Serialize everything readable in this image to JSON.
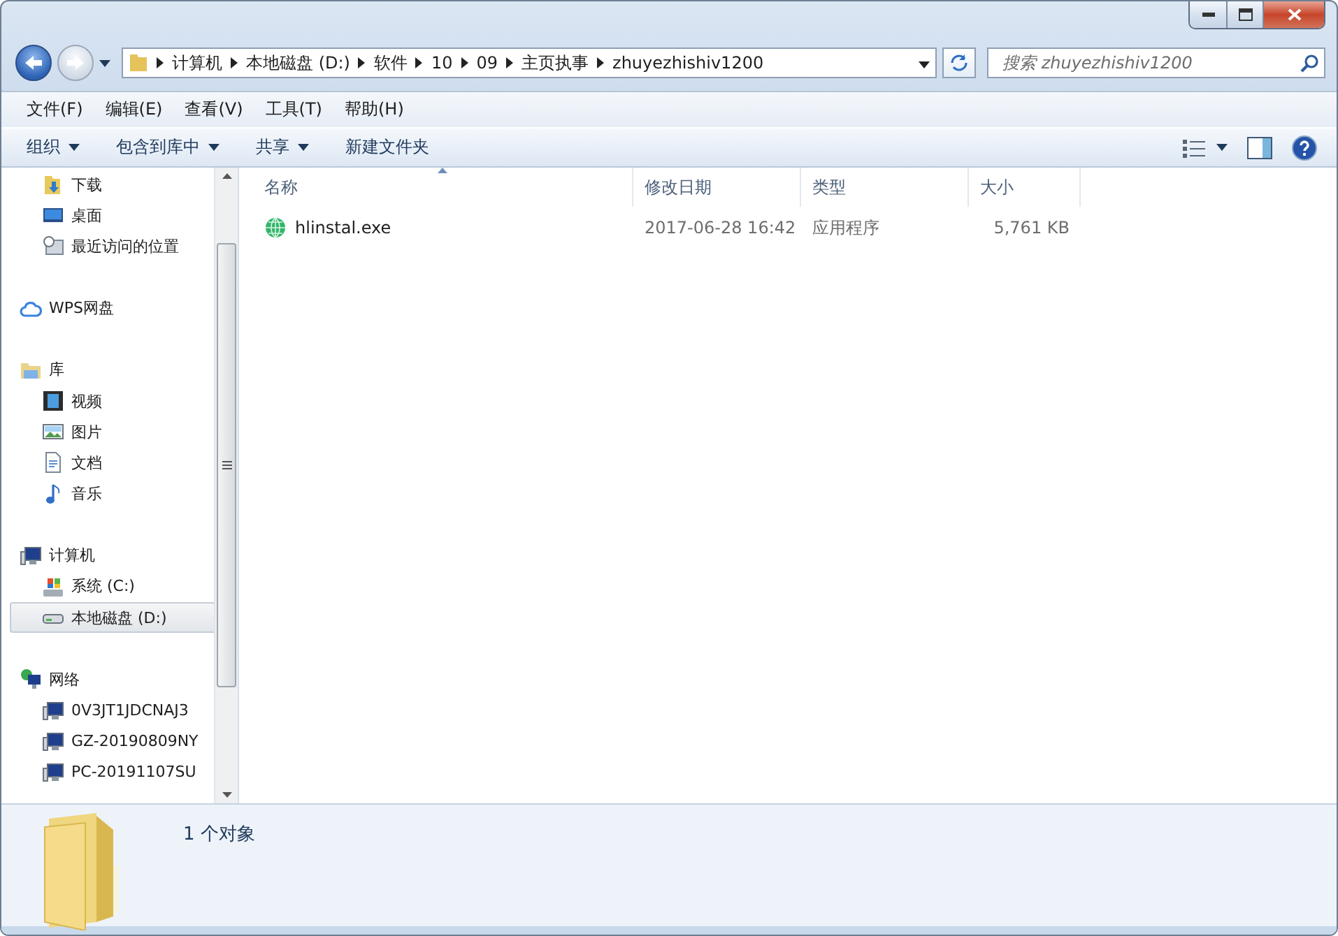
{
  "address_bar": {
    "segments": [
      "计算机",
      "本地磁盘 (D:)",
      "软件",
      "10",
      "09",
      "主页执事",
      "zhuyezhishiv1200"
    ]
  },
  "search": {
    "placeholder": "搜索 zhuyezhishiv1200"
  },
  "menu_bar": [
    "文件(F)",
    "编辑(E)",
    "查看(V)",
    "工具(T)",
    "帮助(H)"
  ],
  "toolbar": [
    {
      "label": "组织",
      "has_menu": true
    },
    {
      "label": "包含到库中",
      "has_menu": true
    },
    {
      "label": "共享",
      "has_menu": true
    },
    {
      "label": "新建文件夹",
      "has_menu": false
    }
  ],
  "sidebar": {
    "favorites_children": [
      {
        "label": "下载",
        "kind": "download",
        "selected": false
      },
      {
        "label": "桌面",
        "kind": "desktop",
        "selected": false
      },
      {
        "label": "最近访问的位置",
        "kind": "recent",
        "selected": false
      }
    ],
    "groups": [
      {
        "label": "WPS网盘",
        "kind": "cloud",
        "selected": false
      },
      {
        "label": "库",
        "kind": "library",
        "selected": false,
        "children": [
          {
            "label": "视频",
            "kind": "video",
            "selected": false
          },
          {
            "label": "图片",
            "kind": "picture",
            "selected": false
          },
          {
            "label": "文档",
            "kind": "document",
            "selected": false
          },
          {
            "label": "音乐",
            "kind": "music",
            "selected": false
          }
        ]
      },
      {
        "label": "计算机",
        "kind": "computer",
        "selected": false,
        "children": [
          {
            "label": "系统 (C:)",
            "kind": "system_drive",
            "selected": false
          },
          {
            "label": "本地磁盘 (D:)",
            "kind": "drive",
            "selected": true
          }
        ]
      },
      {
        "label": "网络",
        "kind": "network",
        "selected": false,
        "children": [
          {
            "label": "0V3JT1JDCNAJ3",
            "kind": "pc",
            "selected": false
          },
          {
            "label": "GZ-20190809NY",
            "kind": "pc",
            "selected": false
          },
          {
            "label": "PC-20191107SU",
            "kind": "pc",
            "selected": false
          }
        ]
      }
    ]
  },
  "file_list": {
    "columns": [
      {
        "label": "名称",
        "sorted": true
      },
      {
        "label": "修改日期",
        "sorted": false
      },
      {
        "label": "类型",
        "sorted": false
      },
      {
        "label": "大小",
        "sorted": false
      }
    ],
    "rows": [
      {
        "name": "hlinstal.exe",
        "modified": "2017-06-28 16:42",
        "type": "应用程序",
        "size": "5,761 KB",
        "selected": false
      }
    ]
  },
  "details_pane": {
    "summary": "1 个对象"
  }
}
